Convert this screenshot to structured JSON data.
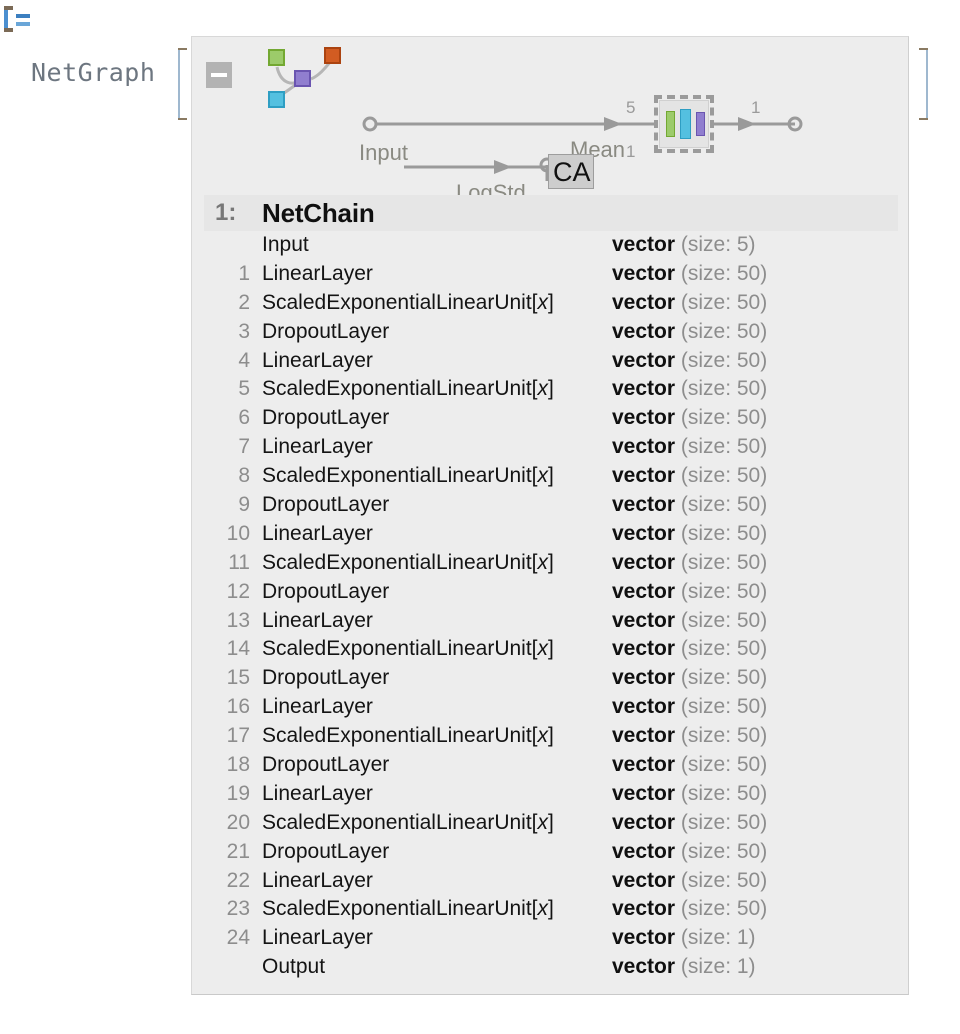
{
  "cell": {
    "marker": "]=",
    "head_label": "NetGraph"
  },
  "graph": {
    "collapse_icon": "minus-icon",
    "glyph_icon": "network-graph-icon",
    "input_port_label": "Input",
    "input_port_count": "2",
    "edge_counts": {
      "into_subnet": "5",
      "to_logstd": "1",
      "from_subnet": "1"
    },
    "output_labels": {
      "mean": "Mean",
      "logstd": "LogStd"
    },
    "overlay_tooltip": "CA",
    "colors": {
      "green": "#9ccb6a",
      "blue": "#54c0e0",
      "purple": "#907ecf",
      "orange": "#d25c22",
      "gray": "#b3b3b3",
      "panel_bg": "#ededed",
      "header_bg": "#e6e6e6"
    }
  },
  "chain": {
    "index_label": "1:",
    "title": "NetChain",
    "rows": [
      {
        "num": "",
        "name": "Input",
        "italic": "",
        "type": "vector",
        "size": "(size: 5)"
      },
      {
        "num": "1",
        "name": "LinearLayer",
        "italic": "",
        "type": "vector",
        "size": "(size: 50)"
      },
      {
        "num": "2",
        "name": "ScaledExponentialLinearUnit[",
        "italic": "x",
        "suffix": "]",
        "type": "vector",
        "size": "(size: 50)"
      },
      {
        "num": "3",
        "name": "DropoutLayer",
        "italic": "",
        "type": "vector",
        "size": "(size: 50)"
      },
      {
        "num": "4",
        "name": "LinearLayer",
        "italic": "",
        "type": "vector",
        "size": "(size: 50)"
      },
      {
        "num": "5",
        "name": "ScaledExponentialLinearUnit[",
        "italic": "x",
        "suffix": "]",
        "type": "vector",
        "size": "(size: 50)"
      },
      {
        "num": "6",
        "name": "DropoutLayer",
        "italic": "",
        "type": "vector",
        "size": "(size: 50)"
      },
      {
        "num": "7",
        "name": "LinearLayer",
        "italic": "",
        "type": "vector",
        "size": "(size: 50)"
      },
      {
        "num": "8",
        "name": "ScaledExponentialLinearUnit[",
        "italic": "x",
        "suffix": "]",
        "type": "vector",
        "size": "(size: 50)"
      },
      {
        "num": "9",
        "name": "DropoutLayer",
        "italic": "",
        "type": "vector",
        "size": "(size: 50)"
      },
      {
        "num": "10",
        "name": "LinearLayer",
        "italic": "",
        "type": "vector",
        "size": "(size: 50)"
      },
      {
        "num": "11",
        "name": "ScaledExponentialLinearUnit[",
        "italic": "x",
        "suffix": "]",
        "type": "vector",
        "size": "(size: 50)"
      },
      {
        "num": "12",
        "name": "DropoutLayer",
        "italic": "",
        "type": "vector",
        "size": "(size: 50)"
      },
      {
        "num": "13",
        "name": "LinearLayer",
        "italic": "",
        "type": "vector",
        "size": "(size: 50)"
      },
      {
        "num": "14",
        "name": "ScaledExponentialLinearUnit[",
        "italic": "x",
        "suffix": "]",
        "type": "vector",
        "size": "(size: 50)"
      },
      {
        "num": "15",
        "name": "DropoutLayer",
        "italic": "",
        "type": "vector",
        "size": "(size: 50)"
      },
      {
        "num": "16",
        "name": "LinearLayer",
        "italic": "",
        "type": "vector",
        "size": "(size: 50)"
      },
      {
        "num": "17",
        "name": "ScaledExponentialLinearUnit[",
        "italic": "x",
        "suffix": "]",
        "type": "vector",
        "size": "(size: 50)"
      },
      {
        "num": "18",
        "name": "DropoutLayer",
        "italic": "",
        "type": "vector",
        "size": "(size: 50)"
      },
      {
        "num": "19",
        "name": "LinearLayer",
        "italic": "",
        "type": "vector",
        "size": "(size: 50)"
      },
      {
        "num": "20",
        "name": "ScaledExponentialLinearUnit[",
        "italic": "x",
        "suffix": "]",
        "type": "vector",
        "size": "(size: 50)"
      },
      {
        "num": "21",
        "name": "DropoutLayer",
        "italic": "",
        "type": "vector",
        "size": "(size: 50)"
      },
      {
        "num": "22",
        "name": "LinearLayer",
        "italic": "",
        "type": "vector",
        "size": "(size: 50)"
      },
      {
        "num": "23",
        "name": "ScaledExponentialLinearUnit[",
        "italic": "x",
        "suffix": "]",
        "type": "vector",
        "size": "(size: 50)"
      },
      {
        "num": "24",
        "name": "LinearLayer",
        "italic": "",
        "type": "vector",
        "size": "(size: 1)"
      },
      {
        "num": "",
        "name": "Output",
        "italic": "",
        "type": "vector",
        "size": "(size: 1)"
      }
    ]
  }
}
